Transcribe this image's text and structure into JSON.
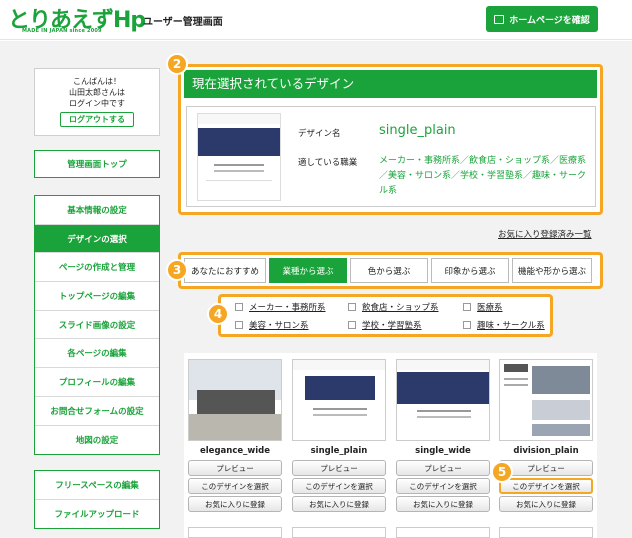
{
  "header": {
    "logo_text": "とりあえずHp",
    "logo_sub": "MADE IN JAPAN since 2009",
    "title": "ユーザー管理画面",
    "home_button": "ホームページを確認"
  },
  "sidebar": {
    "greeting_line1": "こんばんは！",
    "greeting_line2": "山田太郎さんは",
    "greeting_line3": "ログイン中です",
    "logout": "ログアウトする",
    "top": "管理画面トップ",
    "menu": [
      {
        "label": "基本情報の設定"
      },
      {
        "label": "デザインの選択"
      },
      {
        "label": "ページの作成と管理"
      },
      {
        "label": "トップページの編集"
      },
      {
        "label": "スライド画像の設定"
      },
      {
        "label": "各ページの編集"
      },
      {
        "label": "プロフィールの編集"
      },
      {
        "label": "お問合せフォームの設定"
      },
      {
        "label": "地図の設定"
      }
    ],
    "menu2": [
      {
        "label": "フリースペースの編集"
      },
      {
        "label": "ファイルアップロード"
      }
    ]
  },
  "selected": {
    "heading": "現在選択されているデザイン",
    "design_label": "デザイン名",
    "design_value": "single_plain",
    "job_label": "適している職業",
    "job_value": "メーカー・事務所系／飲食店・ショップ系／医療系／美容・サロン系／学校・学習塾系／趣味・サークル系"
  },
  "favorites_link": "お気に入り登録済み一覧",
  "tabs": [
    {
      "label": "あなたにおすすめ"
    },
    {
      "label": "業種から選ぶ"
    },
    {
      "label": "色から選ぶ"
    },
    {
      "label": "印象から選ぶ"
    },
    {
      "label": "機能や形から選ぶ"
    }
  ],
  "categories": [
    {
      "label": "メーカー・事務所系"
    },
    {
      "label": "飲食店・ショップ系"
    },
    {
      "label": "医療系"
    },
    {
      "label": "美容・サロン系"
    },
    {
      "label": "学校・学習塾系"
    },
    {
      "label": "趣味・サークル系"
    }
  ],
  "badges": [
    "2",
    "3",
    "4",
    "5"
  ],
  "cards": [
    {
      "name": "elegance_wide"
    },
    {
      "name": "single_plain"
    },
    {
      "name": "single_wide"
    },
    {
      "name": "division_plain"
    }
  ],
  "card_buttons": {
    "preview": "プレビュー",
    "select": "このデザインを選択",
    "favorite": "お気に入りに登録"
  },
  "colors": {
    "brand_green": "#1aa33a",
    "highlight_orange": "#f5a623"
  }
}
